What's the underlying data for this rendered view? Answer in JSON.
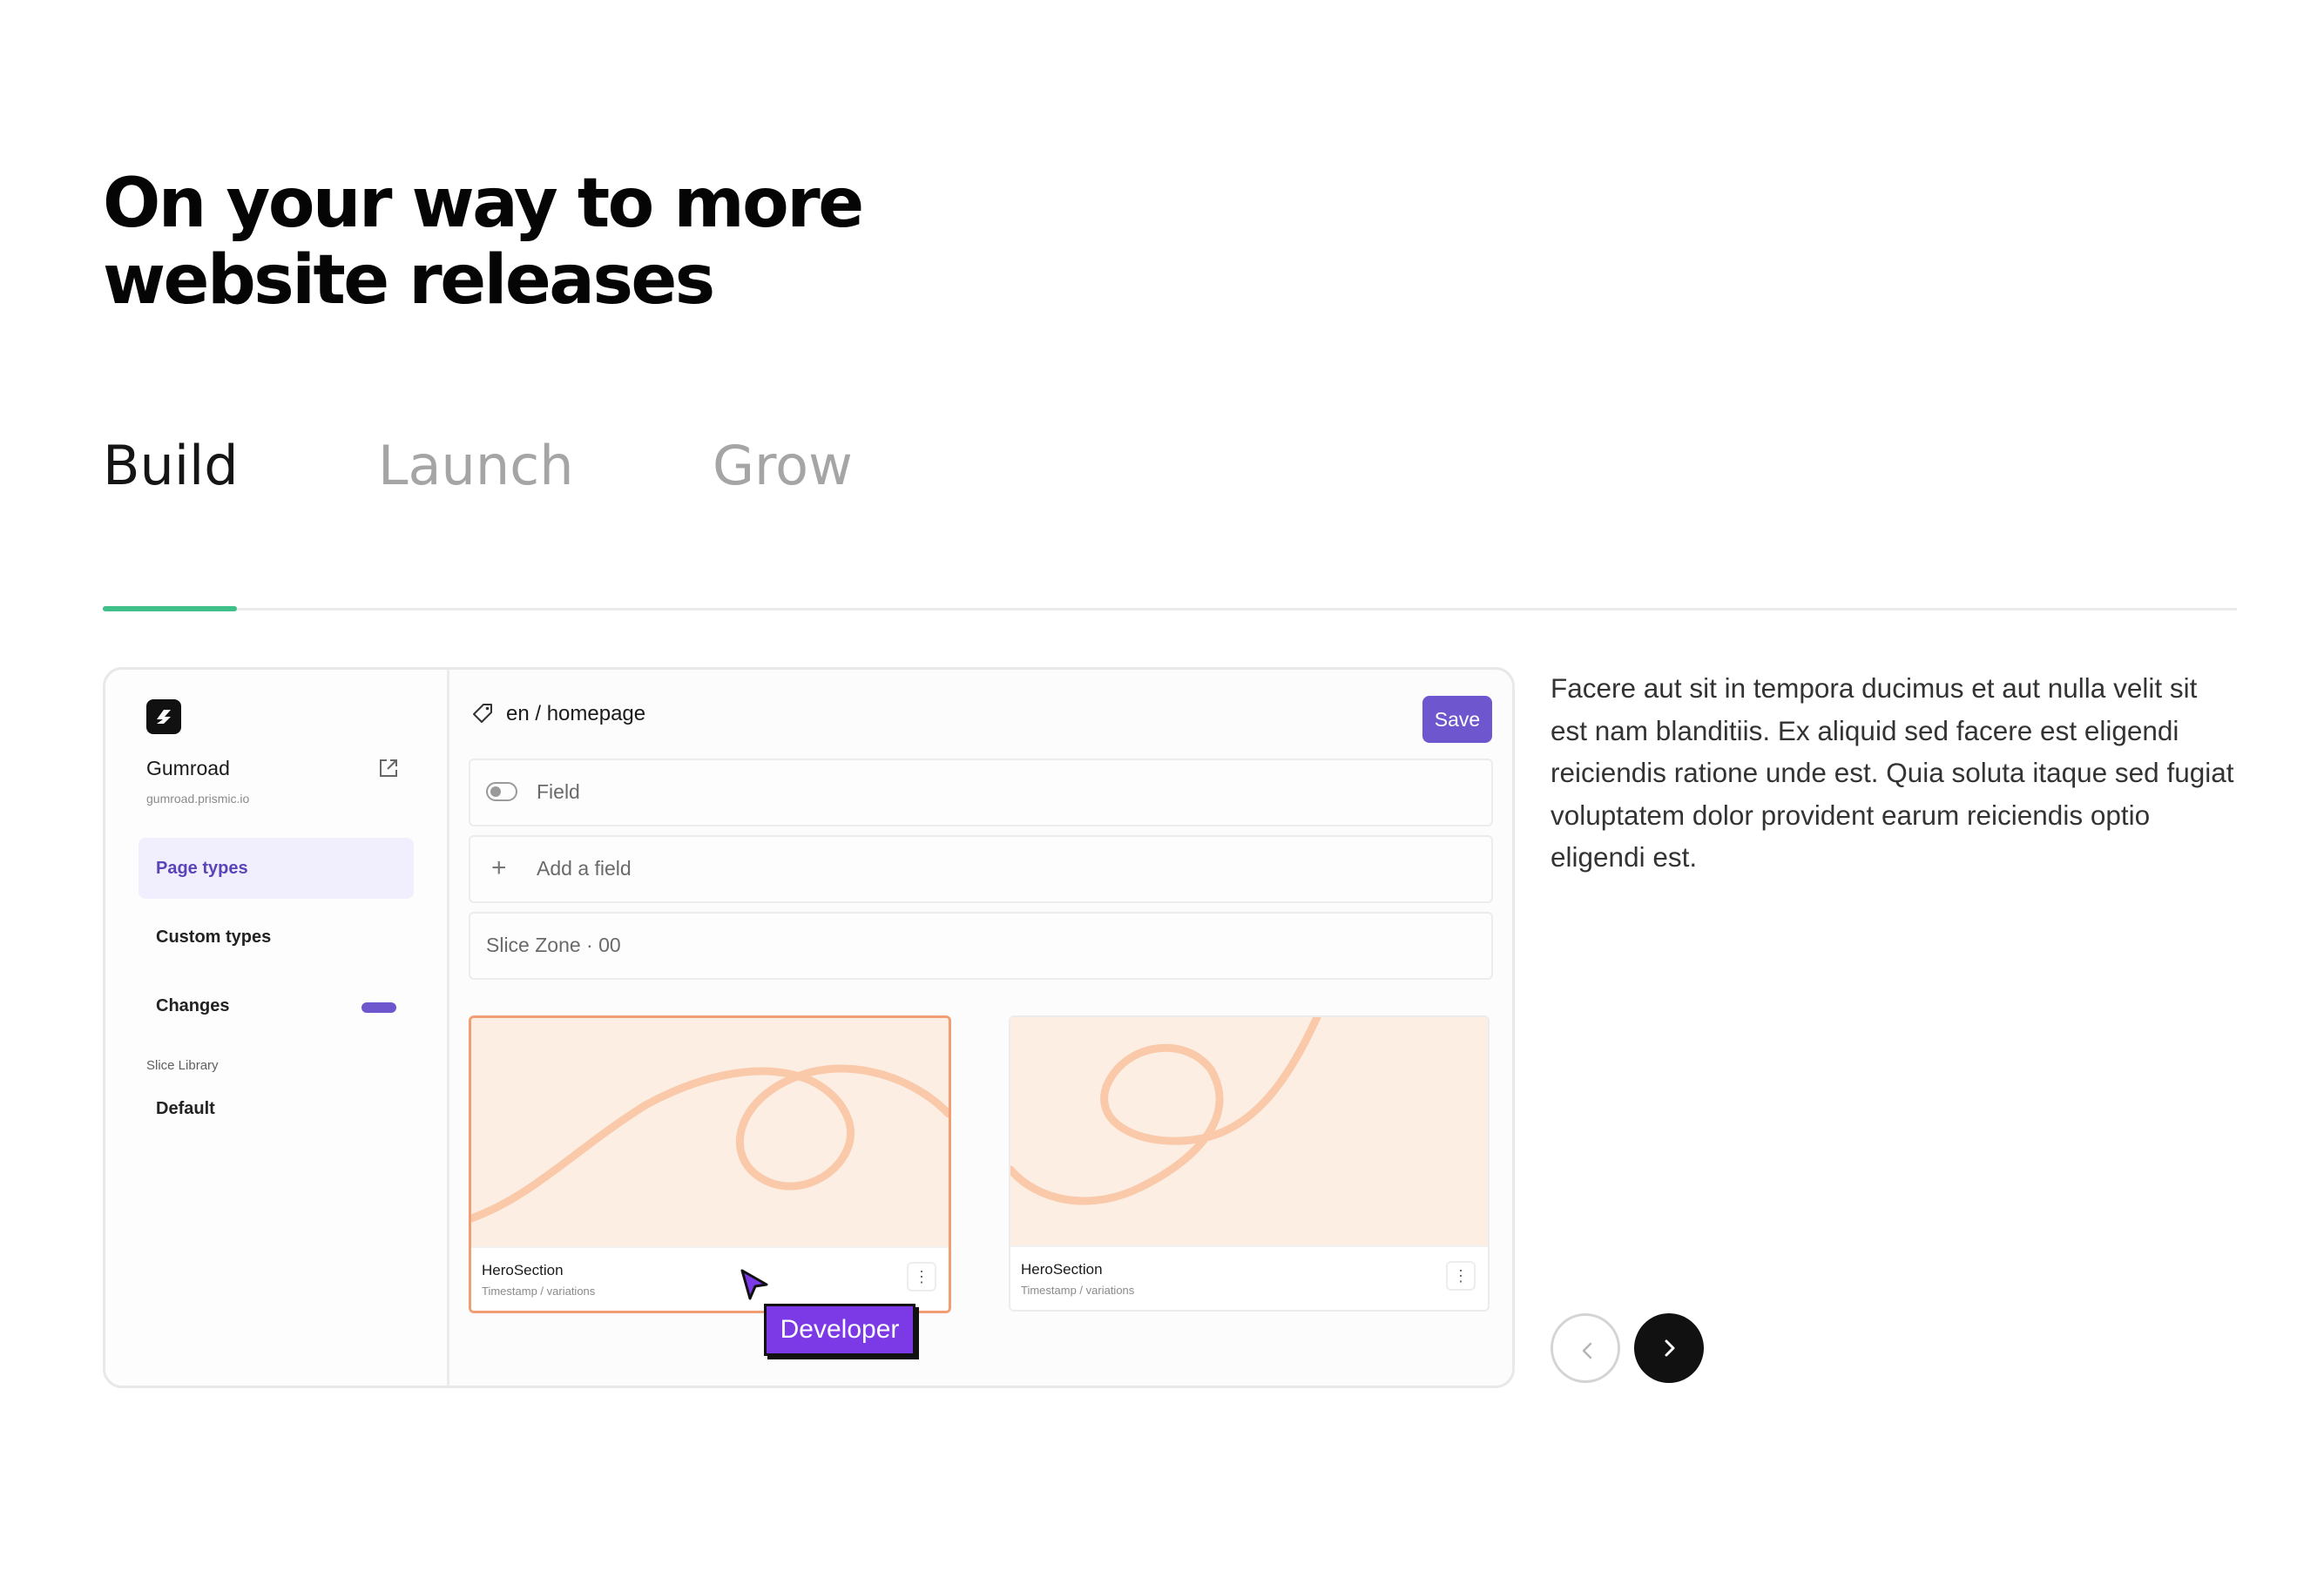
{
  "headline": "On your way to more website releases",
  "tabs": [
    {
      "label": "Build",
      "active": true
    },
    {
      "label": "Launch",
      "active": false
    },
    {
      "label": "Grow",
      "active": false
    }
  ],
  "progress": {
    "value": 0.063,
    "color": "#3fbf8a"
  },
  "app": {
    "sidebar": {
      "repo_name": "Gumroad",
      "repo_url": "gumroad.prismic.io",
      "items": [
        {
          "label": "Page types",
          "active": true
        },
        {
          "label": "Custom types",
          "active": false
        },
        {
          "label": "Changes",
          "active": false
        }
      ],
      "section_label": "Slice Library",
      "library_item": "Default"
    },
    "editor": {
      "path": "en / homepage",
      "save_label": "Save",
      "rows": [
        "Field",
        "Add a field",
        "Slice Zone · 00"
      ],
      "cards": [
        {
          "name": "HeroSection",
          "subtitle": "Timestamp / variations",
          "selected": true
        },
        {
          "name": "HeroSection",
          "subtitle": "Timestamp / variations",
          "selected": false
        }
      ]
    },
    "cursor_tag": "Developer"
  },
  "description": "Facere aut sit in tempora ducimus et aut nulla velit sit est nam blanditiis. Ex aliquid sed facere est eligendi reiciendis ratione unde est. Quia soluta itaque sed fugiat voluptatem dolor provident earum reiciendis optio eligendi est.",
  "colors": {
    "accent": "#6e56cf",
    "developer_tag": "#7c3ae6",
    "card_art": "#fdeee4",
    "card_selected_border": "#f29e74"
  },
  "icons": {
    "logo": "prismic-logo-icon",
    "external": "external-link-icon",
    "tag": "tag-icon",
    "prev": "chevron-left-icon",
    "next": "chevron-right-icon",
    "cursor": "mouse-cursor-icon",
    "more": "more-vertical-icon"
  }
}
